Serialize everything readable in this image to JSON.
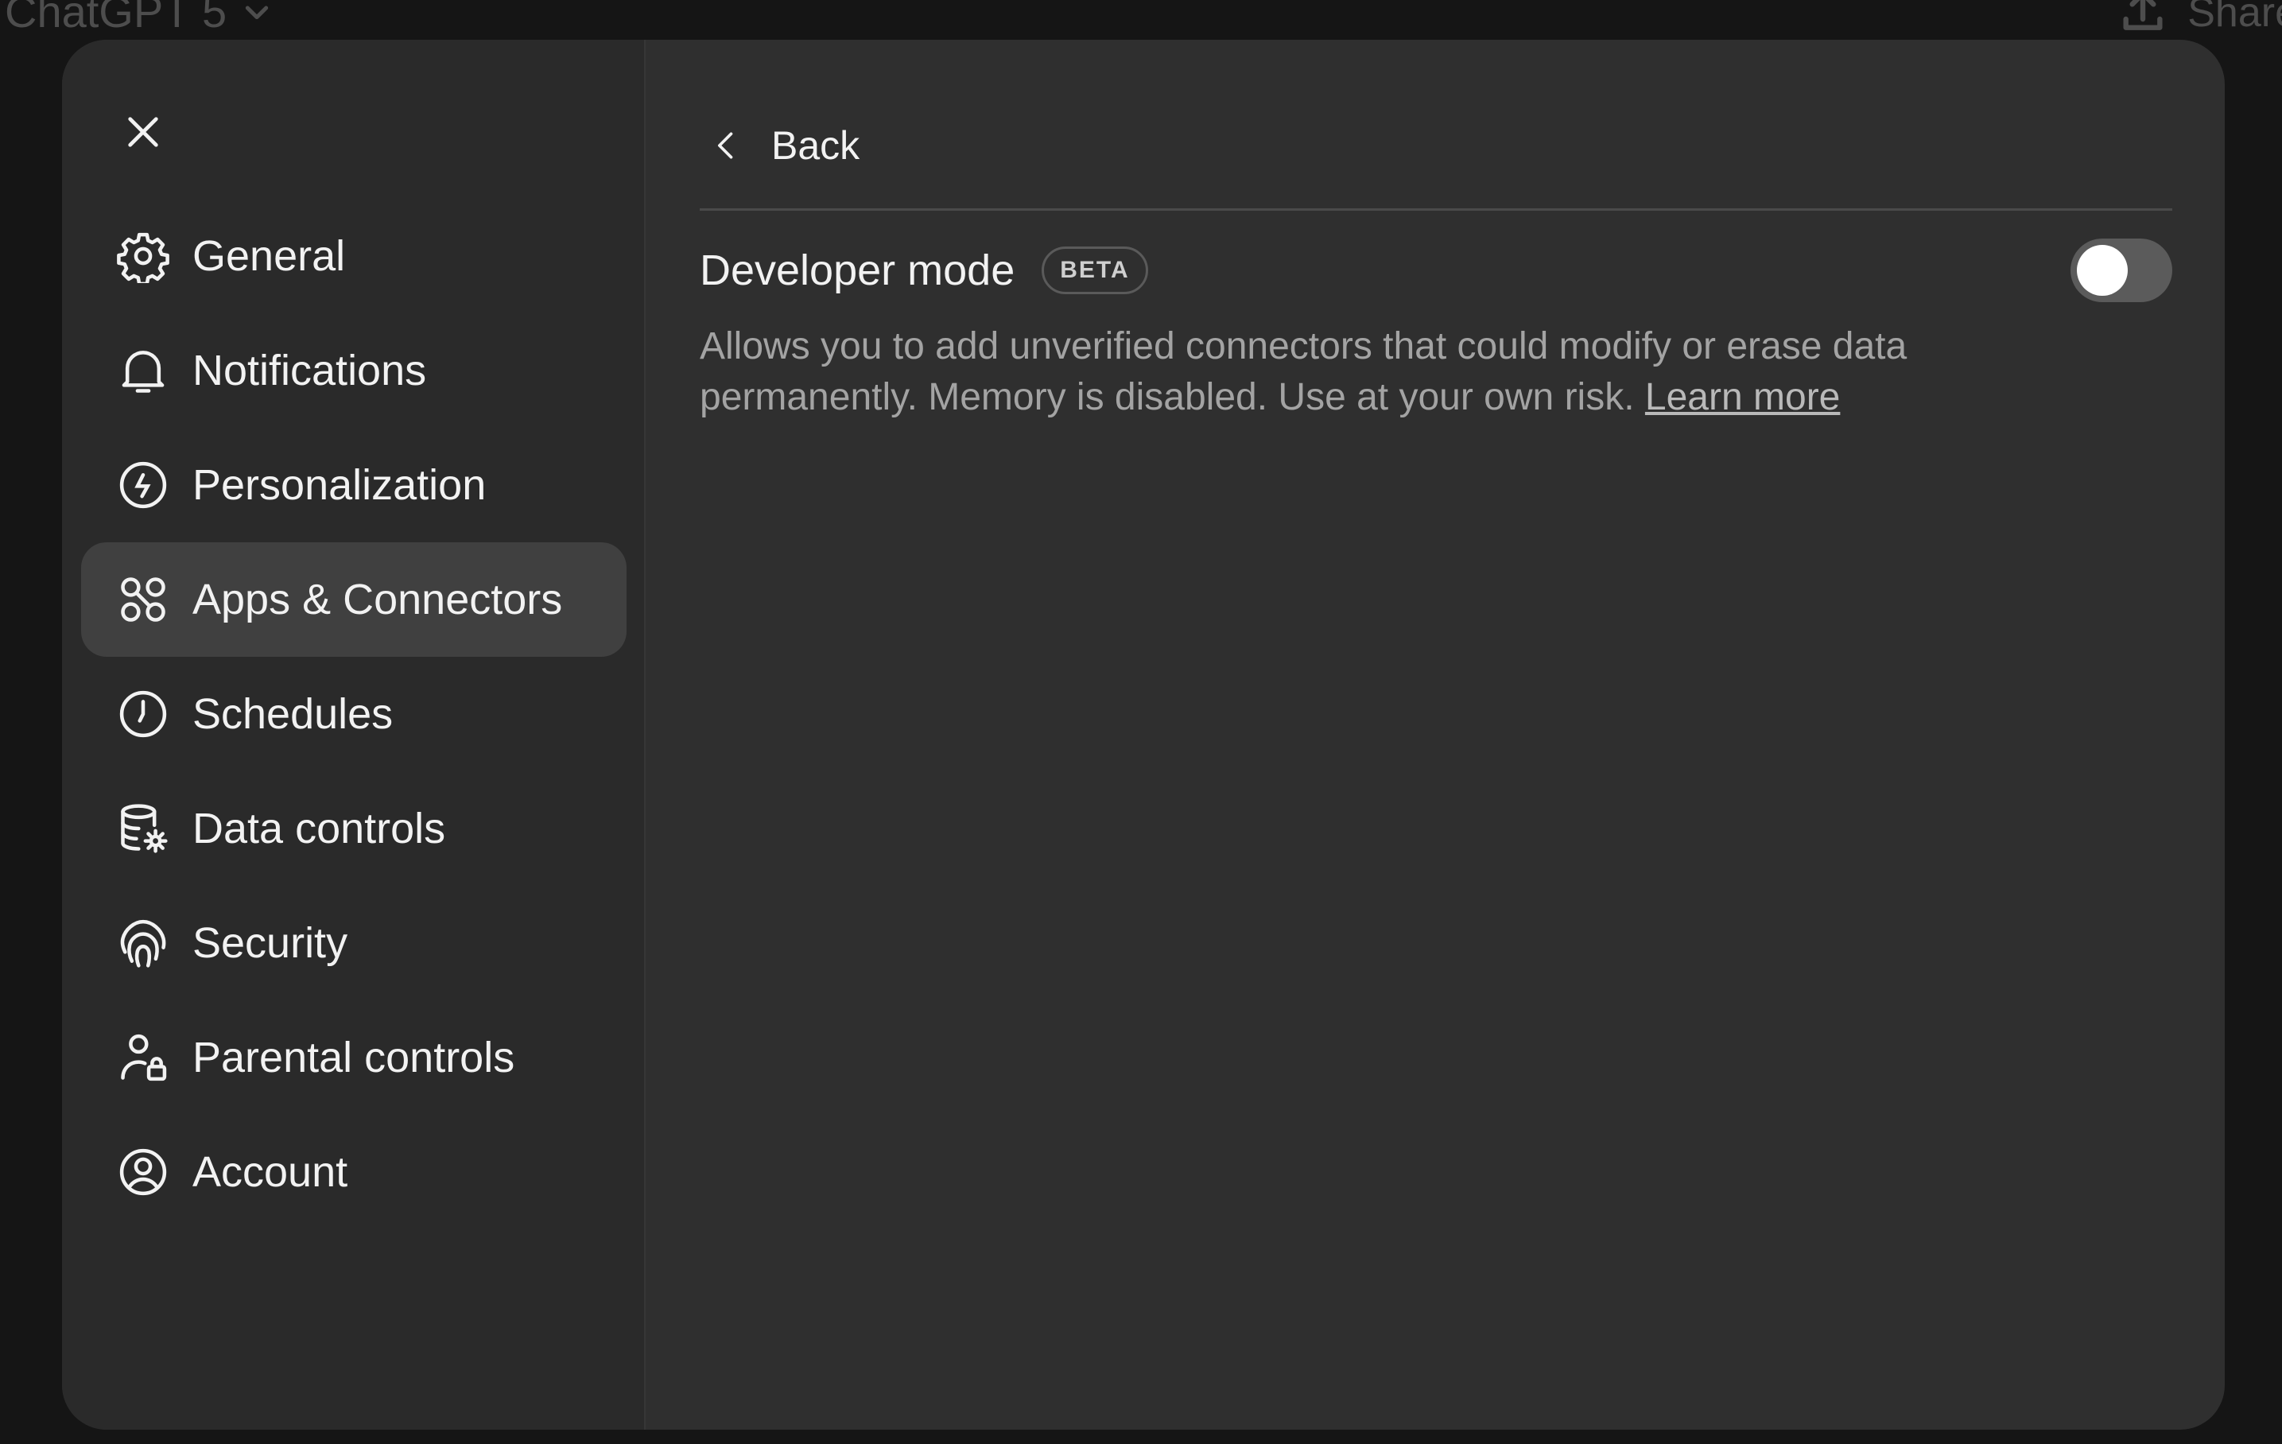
{
  "background": {
    "title": "ChatGPT 5",
    "share_label": "Share"
  },
  "sidebar": {
    "close_icon": "close-icon",
    "items": [
      {
        "label": "General",
        "icon": "gear-icon",
        "active": false
      },
      {
        "label": "Notifications",
        "icon": "bell-icon",
        "active": false
      },
      {
        "label": "Personalization",
        "icon": "personalization-icon",
        "active": false
      },
      {
        "label": "Apps & Connectors",
        "icon": "apps-icon",
        "active": true
      },
      {
        "label": "Schedules",
        "icon": "clock-icon",
        "active": false
      },
      {
        "label": "Data controls",
        "icon": "database-gear-icon",
        "active": false
      },
      {
        "label": "Security",
        "icon": "fingerprint-icon",
        "active": false
      },
      {
        "label": "Parental controls",
        "icon": "user-lock-icon",
        "active": false
      },
      {
        "label": "Account",
        "icon": "user-circle-icon",
        "active": false
      }
    ]
  },
  "content": {
    "back_label": "Back",
    "setting": {
      "title": "Developer mode",
      "badge": "BETA",
      "toggle_on": false,
      "description": "Allows you to add unverified connectors that could modify or erase data permanently. Memory is disabled. Use at your own risk.",
      "link_label": "Learn more"
    }
  },
  "colors": {
    "modal_bg": "#2f2f2f",
    "sidebar_bg": "#2a2a2a",
    "active_item_bg": "#404040",
    "toggle_off": "#5b5b5b"
  }
}
